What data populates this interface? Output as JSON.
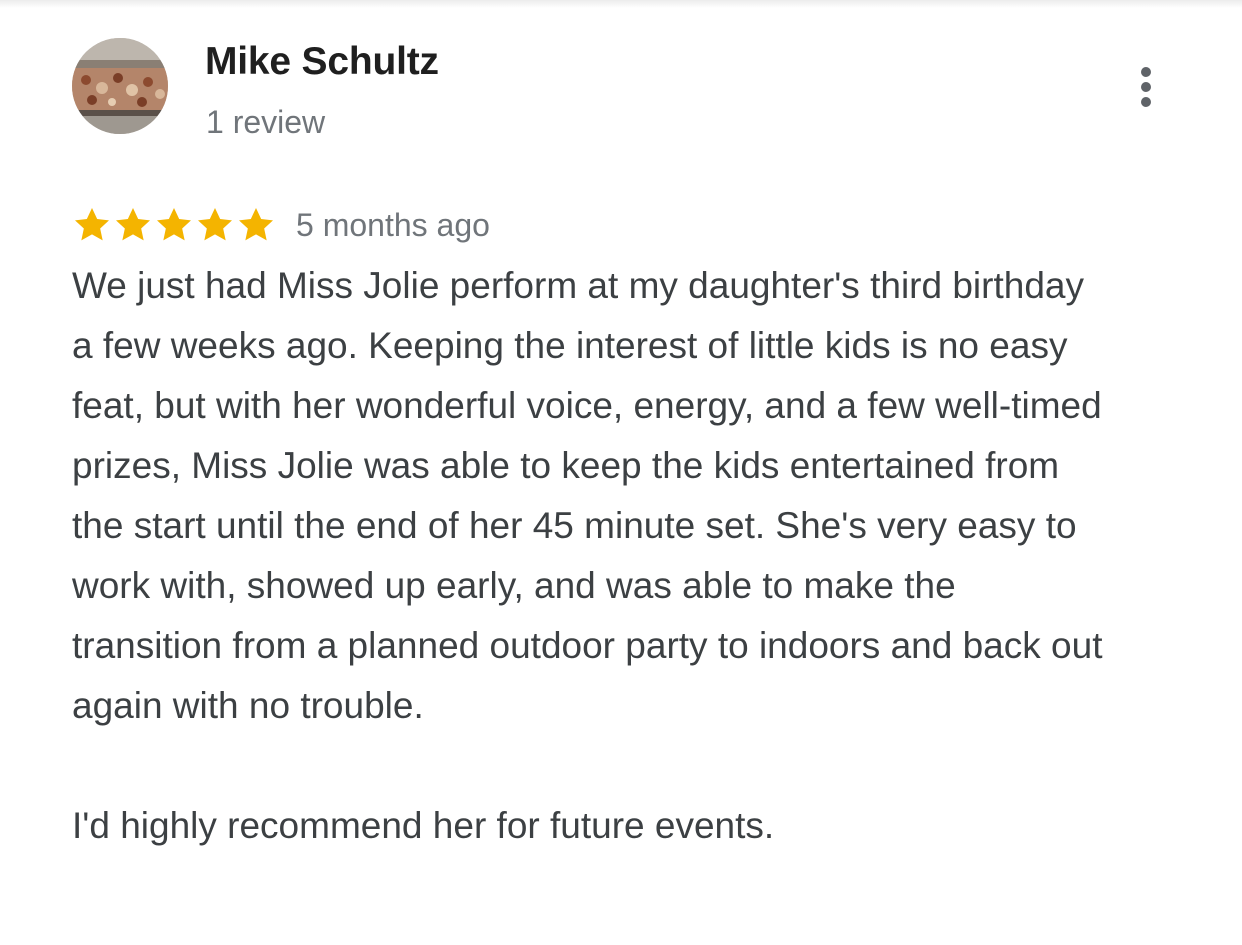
{
  "review": {
    "author": {
      "name": "Mike Schultz",
      "meta": "1 review",
      "avatar_icon": "food-photo-avatar"
    },
    "menu_icon": "more-vert-icon",
    "rating": {
      "stars": 5,
      "max": 5,
      "color": "#F4B400"
    },
    "date": "5 months ago",
    "paragraphs": [
      "We just had Miss Jolie perform at my daughter's third birthday a few weeks ago.  Keeping the interest of little kids is no easy feat, but with her wonderful voice, energy, and a few well-timed prizes, Miss Jolie was able to keep the kids entertained from the start until the end of her 45 minute set.  She's very easy to work with, showed up early, and was able to make the transition from a planned outdoor party to indoors and back out again with no trouble.",
      "I'd highly recommend her for future events."
    ]
  }
}
